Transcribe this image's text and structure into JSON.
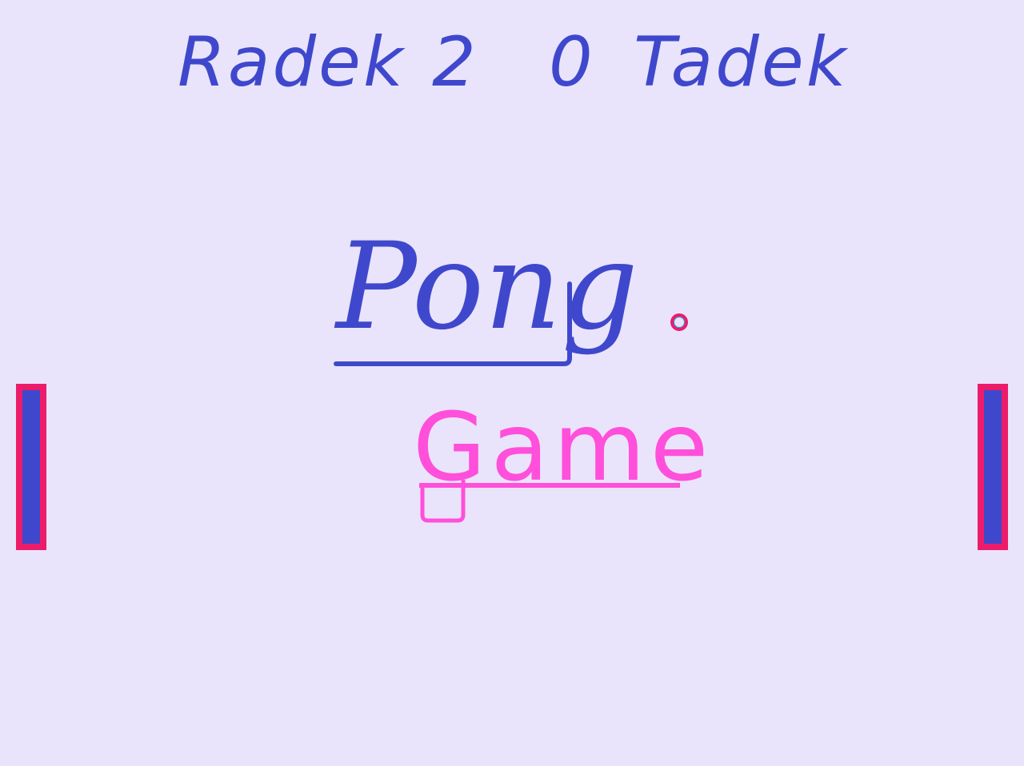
{
  "scoreboard": {
    "player1_name": "Radek",
    "player1_score": "2",
    "player2_score": "0",
    "player2_name": "Tadek"
  },
  "title": {
    "line1": "Pong",
    "line2": "Game"
  },
  "colors": {
    "background": "#e9e4fb",
    "score_text": "#3f48cc",
    "title_pong": "#3f48cc",
    "title_game": "#ff4fdb",
    "paddle_fill": "#3f48cc",
    "paddle_border": "#ec1c6a",
    "ball_outline": "#ec1c6a"
  }
}
